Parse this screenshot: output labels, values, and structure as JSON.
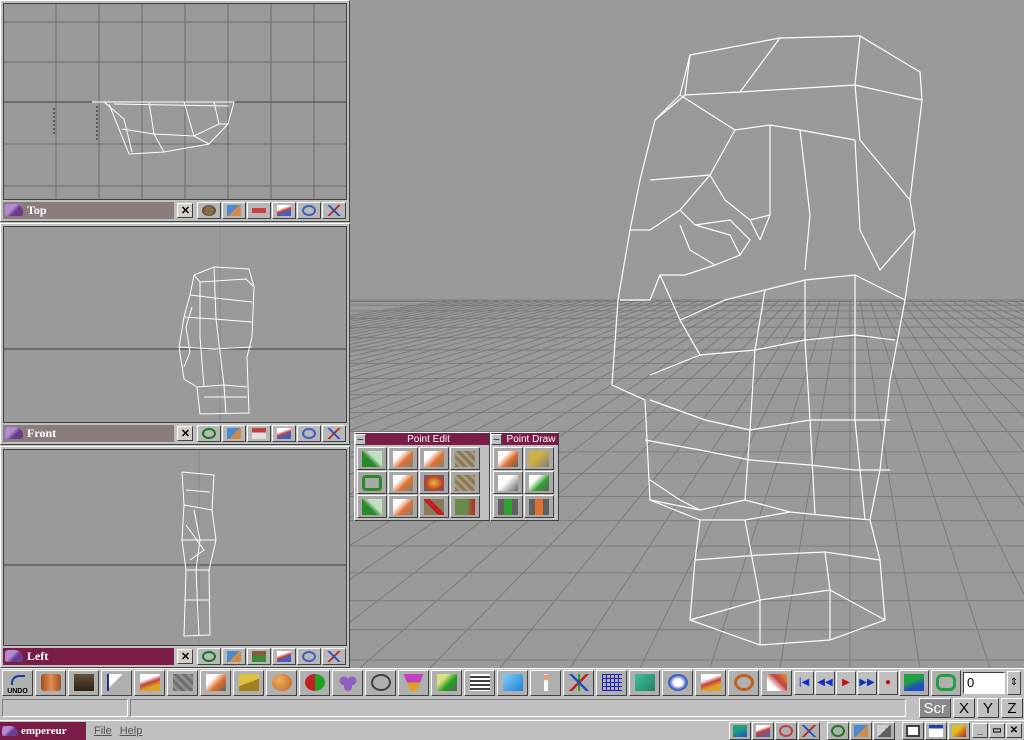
{
  "viewports": [
    {
      "id": "top",
      "label": "Top",
      "active": false
    },
    {
      "id": "front",
      "label": "Front",
      "active": false
    },
    {
      "id": "left",
      "label": "Left",
      "active": true
    }
  ],
  "viewport_close_glyph": "✕",
  "palettes": {
    "point_edit": {
      "title": "Point Edit",
      "minimize": "–"
    },
    "point_draw": {
      "title": "Point Draw",
      "minimize": "–"
    }
  },
  "toolbar": {
    "undo_label": "UNDO",
    "frame_value": "0",
    "playback": [
      "|◀",
      "◀◀",
      "▶",
      "▶▶",
      "●"
    ]
  },
  "status": {
    "scr_label": "Scr",
    "axes": [
      "X",
      "Y",
      "Z"
    ]
  },
  "taskbar": {
    "app_name": "empereur",
    "menu": [
      "File",
      "Help"
    ],
    "window_buttons": [
      "_",
      "▭",
      "✕"
    ]
  },
  "colors": {
    "viewport_bg": "#9a9a9a",
    "active_title": "#7a1c48",
    "inactive_title": "#8c7d7d",
    "wireframe": "#ffffff"
  }
}
